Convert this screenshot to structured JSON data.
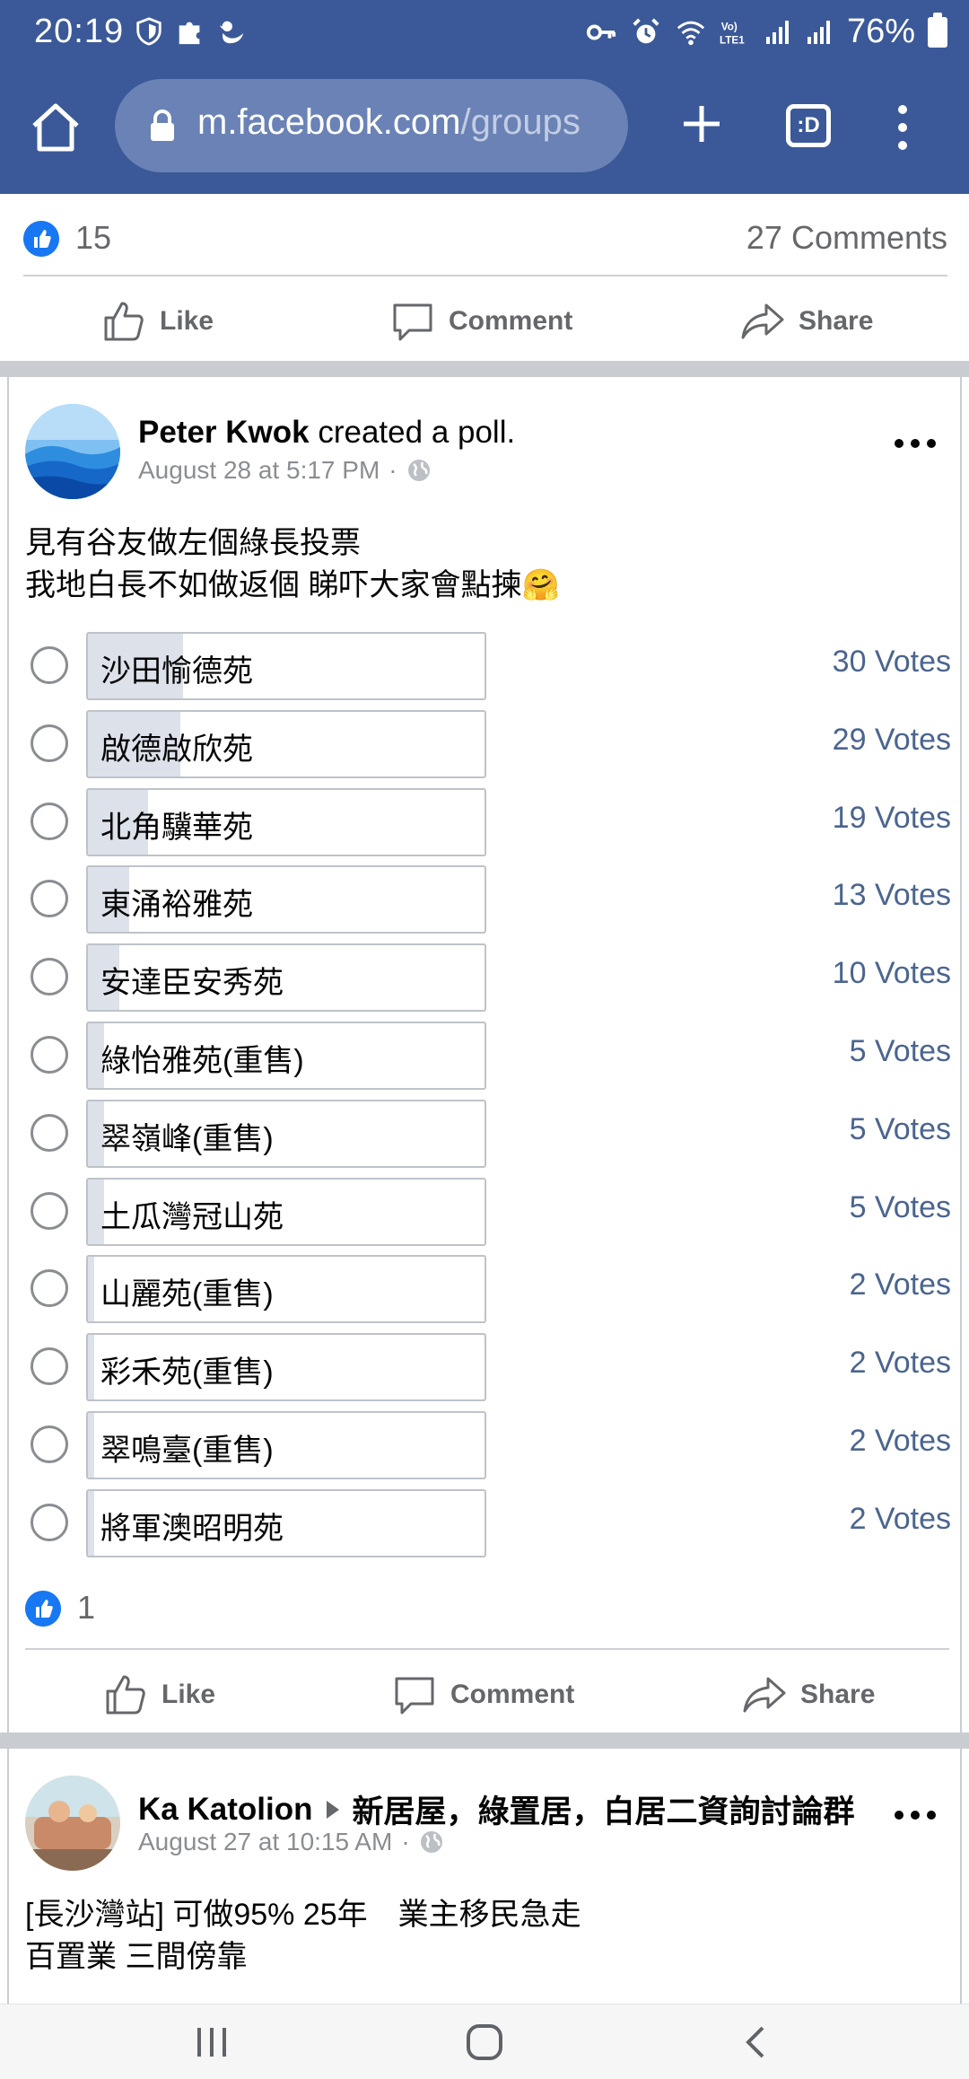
{
  "status_bar": {
    "time": "20:19",
    "battery": "76%",
    "icons": [
      "shield-icon",
      "puzzle-icon",
      "duck-icon",
      "key-icon",
      "alarm-icon",
      "wifi-icon",
      "volte-icon",
      "signal-icon",
      "signal-icon",
      "battery-icon"
    ]
  },
  "browser": {
    "url_host": "m.facebook.com",
    "url_path": "/groups",
    "tab_label": ":D"
  },
  "prev_post": {
    "reaction_count": "15",
    "comments": "27 Comments"
  },
  "actions": {
    "like": "Like",
    "comment": "Comment",
    "share": "Share"
  },
  "poll_post": {
    "author": "Peter Kwok",
    "action_text": " created a poll.",
    "timestamp": "August 28 at 5:17 PM",
    "meta_sep": "·",
    "text_line1": "見有谷友做左個綠長投票",
    "text_line2": "我地白長不如做返個 睇吓大家會點揀🤗",
    "options": [
      {
        "label": "沙田愉德苑",
        "votes": "30 Votes",
        "share": 30
      },
      {
        "label": "啟德啟欣苑",
        "votes": "29 Votes",
        "share": 29
      },
      {
        "label": "北角驥華苑",
        "votes": "19 Votes",
        "share": 19
      },
      {
        "label": "東涌裕雅苑",
        "votes": "13 Votes",
        "share": 13
      },
      {
        "label": "安達臣安秀苑",
        "votes": "10 Votes",
        "share": 10
      },
      {
        "label": "綠怡雅苑(重售)",
        "votes": "5 Votes",
        "share": 5
      },
      {
        "label": "翠嶺峰(重售)",
        "votes": "5 Votes",
        "share": 5
      },
      {
        "label": "土瓜灣冠山苑",
        "votes": "5 Votes",
        "share": 5
      },
      {
        "label": "山麗苑(重售)",
        "votes": "2 Votes",
        "share": 2
      },
      {
        "label": "彩禾苑(重售)",
        "votes": "2 Votes",
        "share": 2
      },
      {
        "label": "翠鳴臺(重售)",
        "votes": "2 Votes",
        "share": 2
      },
      {
        "label": "將軍澳昭明苑",
        "votes": "2 Votes",
        "share": 2
      }
    ],
    "reaction_count": "1"
  },
  "next_post": {
    "author": "Ka Katolion",
    "group": "新居屋，綠置居，白居二資詢討論群",
    "timestamp": "August 27 at 10:15 AM",
    "meta_sep": "·",
    "text_line1": "[長沙灣站] 可做95% 25年　業主移民急走",
    "text_line2": "百置業 三間傍靠"
  },
  "colors": {
    "header": "#3b5998",
    "like_blue": "#1877f2",
    "vote_text": "#4b6590",
    "poll_fill": "#dde1ea"
  }
}
